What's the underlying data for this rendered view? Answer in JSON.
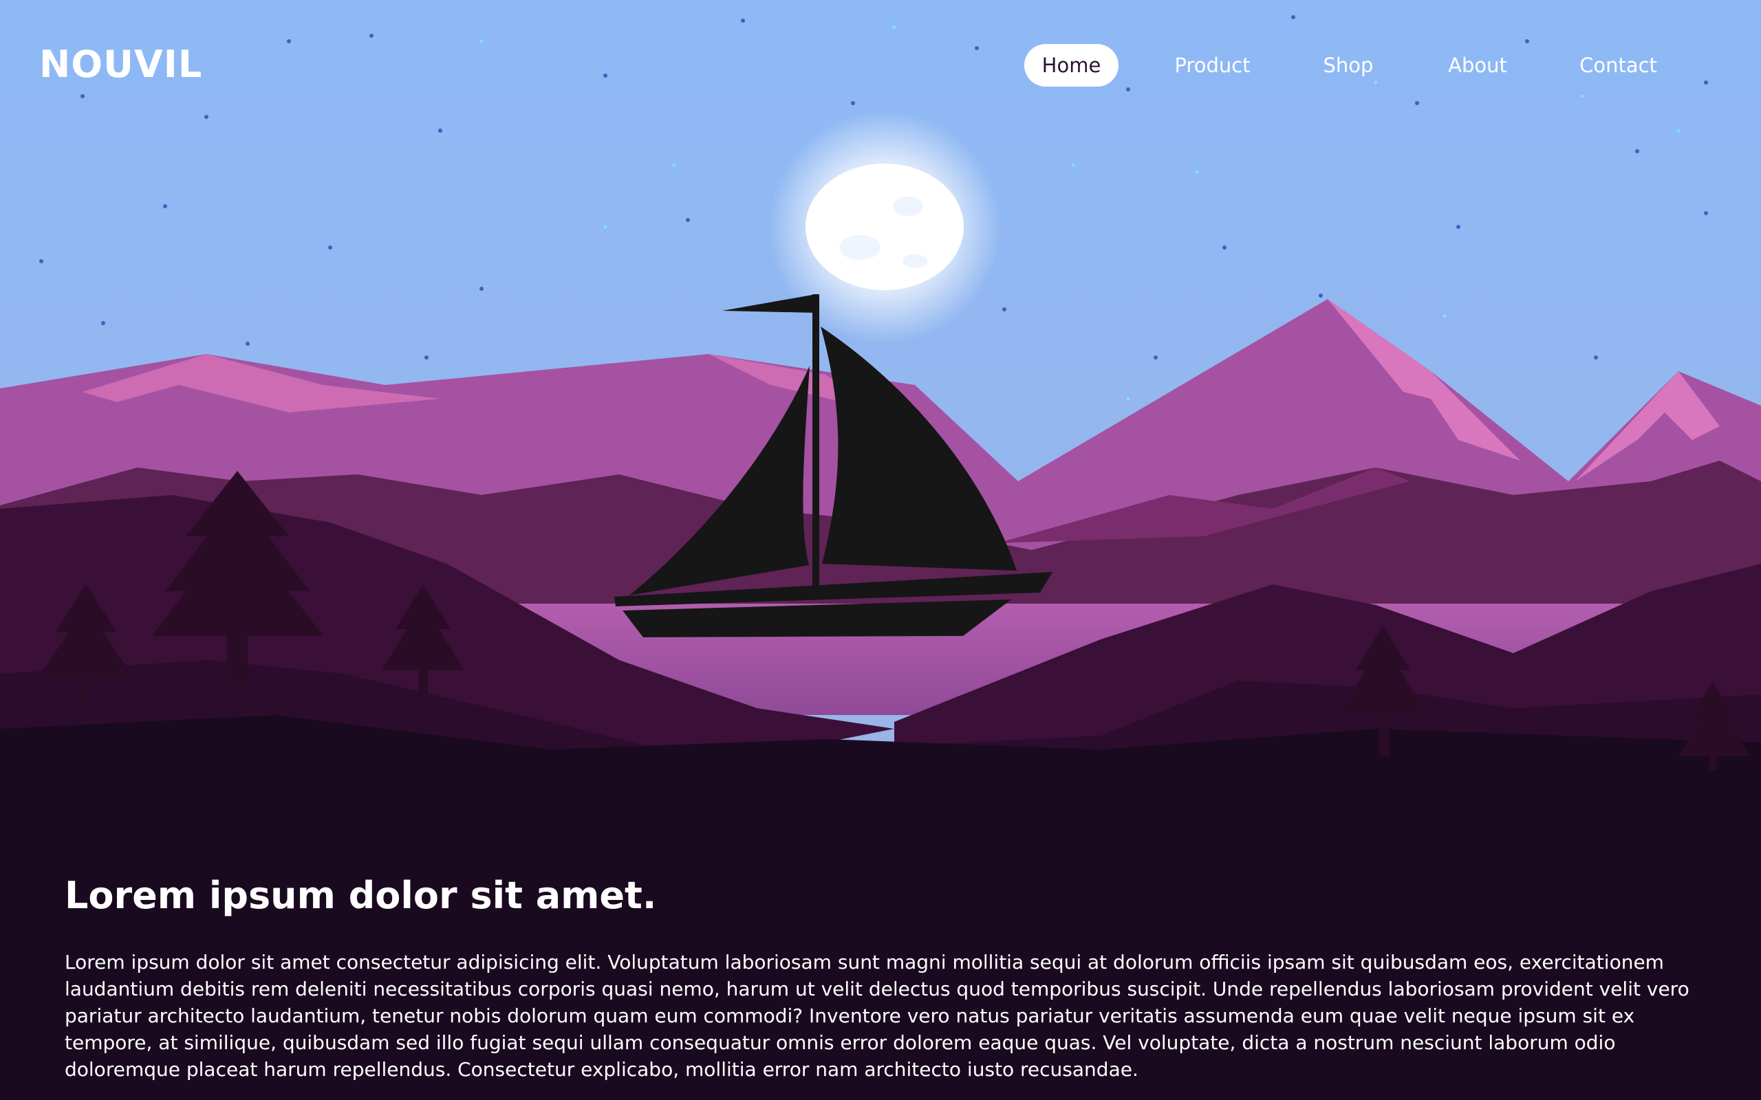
{
  "brand": {
    "logo_text": "NOUVIL"
  },
  "nav": {
    "items": [
      {
        "label": "Home",
        "active": true
      },
      {
        "label": "Product",
        "active": false
      },
      {
        "label": "Shop",
        "active": false
      },
      {
        "label": "About",
        "active": false
      },
      {
        "label": "Contact",
        "active": false
      }
    ]
  },
  "hero": {
    "illustration": "night-landscape-sailboat-illustration",
    "colors": {
      "sky_top": "#8ab6f5",
      "sky_bottom": "#9cb4e6",
      "mountain_light": "#a45aa6",
      "mountain_peak": "#d370b4",
      "hills_mid": "#5e2258",
      "hills_dark": "#3a0f3a",
      "ground": "#1a0a20",
      "boat": "#161616"
    }
  },
  "article": {
    "heading": "Lorem ipsum dolor sit amet.",
    "body": "Lorem ipsum dolor sit amet consectetur adipisicing elit. Voluptatum laboriosam sunt magni mollitia sequi at dolorum officiis ipsam sit quibusdam eos, exercitationem laudantium debitis rem deleniti necessitatibus corporis quasi nemo, harum ut velit delectus quod temporibus suscipit. Unde repellendus laboriosam provident velit vero pariatur architecto laudantium, tenetur nobis dolorum quam eum commodi? Inventore vero natus pariatur veritatis assumenda eum quae velit neque ipsum sit ex tempore, at similique, quibusdam sed illo fugiat sequi ullam consequatur omnis error dolorem eaque quas. Vel voluptate, dicta a nostrum nesciunt laborum odio doloremque placeat harum repellendus. Consectetur explicabo, mollitia error nam architecto iusto recusandae."
  }
}
